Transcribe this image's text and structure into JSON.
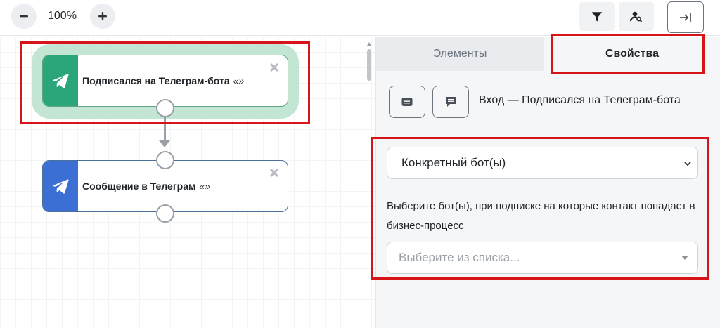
{
  "toolbar": {
    "zoom_value": "100%",
    "zoom_out_icon": "minus-icon",
    "zoom_in_icon": "plus-icon",
    "filter_icon": "filter-icon",
    "user_search_icon": "user-search-icon",
    "exit_icon": "arrow-to-right-icon"
  },
  "canvas": {
    "nodes": [
      {
        "title": "Подписался на Телеграм-бота",
        "quote": "«»",
        "icon": "telegram-plane-icon",
        "color": "#2aa67a"
      },
      {
        "title": "Сообщение в Телеграм",
        "quote": "«»",
        "icon": "telegram-plane-icon",
        "color": "#3b6fd4"
      }
    ]
  },
  "panel": {
    "tabs": [
      {
        "label": "Элементы"
      },
      {
        "label": "Свойства"
      }
    ],
    "entry_title": "Вход — Подписался на Телеграм-бота",
    "bot_mode_select": "Конкретный бот(ы)",
    "help_text": "Выберите бот(ы), при подписке на которые контакт попадает в бизнес-процесс",
    "bot_picker_placeholder": "Выберите из списка..."
  },
  "colors": {
    "highlight": "#d7141a",
    "accent_green": "#2aa67a",
    "accent_blue": "#3b6fd4"
  }
}
